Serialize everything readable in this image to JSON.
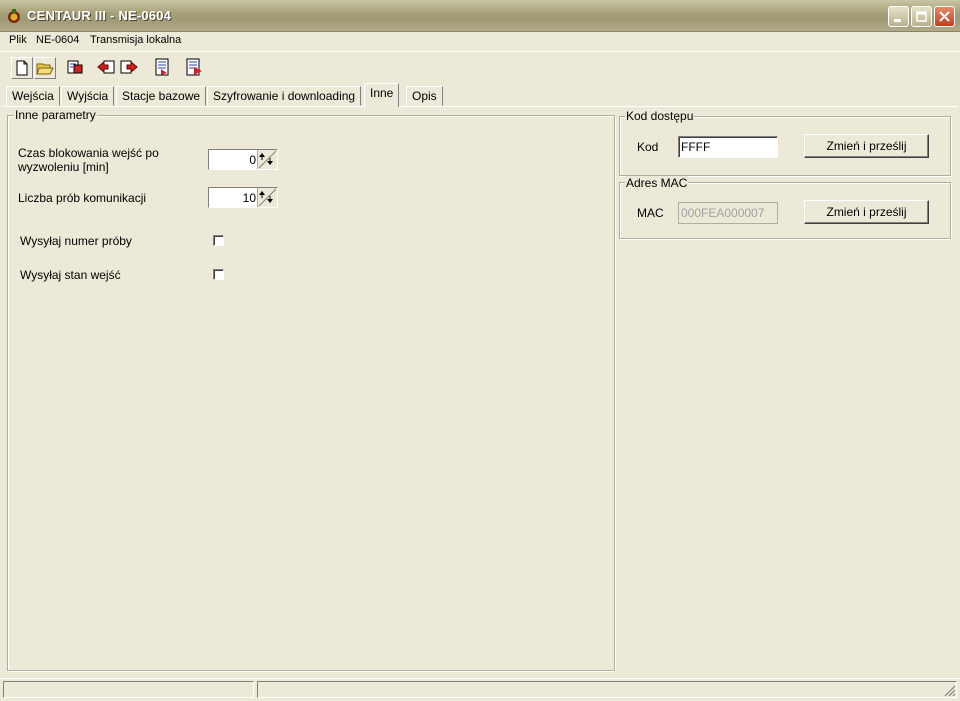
{
  "window": {
    "title": "CENTAUR III -  NE-0604"
  },
  "menu": {
    "items": [
      "Plik",
      "NE-0604",
      "Transmisja lokalna"
    ]
  },
  "toolbar": {
    "buttons": [
      {
        "icon": "new-file-icon"
      },
      {
        "icon": "open-folder-icon"
      },
      {
        "icon": "read-device-icon"
      },
      {
        "icon": "send-left-icon"
      },
      {
        "icon": "send-right-icon"
      },
      {
        "icon": "export-icon"
      },
      {
        "icon": "import-icon"
      }
    ]
  },
  "tabs": [
    "Wejścia",
    "Wyjścia",
    "Stacje bazowe",
    "Szyfrowanie i downloading",
    "Inne",
    "Opis"
  ],
  "active_tab": "Inne",
  "inne_parametry": {
    "title": "Inne parametry",
    "blocking_time": {
      "label_line1": "Czas blokowania wejść po",
      "label_line2": "wyzwoleniu [min]",
      "value": "0"
    },
    "comm_attempts": {
      "label": "Liczba prób komunikacji",
      "value": "10"
    },
    "send_attempt_number": {
      "label": "Wysyłaj numer próby",
      "checked": false
    },
    "send_input_state": {
      "label": "Wysyłaj stan wejść",
      "checked": false
    }
  },
  "kod_dostepu": {
    "title": "Kod dostępu",
    "label": "Kod",
    "value": "FFFF",
    "button": "Zmień i prześlij"
  },
  "adres_mac": {
    "title": "Adres MAC",
    "label": "MAC",
    "value": "000FEA000007",
    "button": "Zmień i prześlij"
  }
}
